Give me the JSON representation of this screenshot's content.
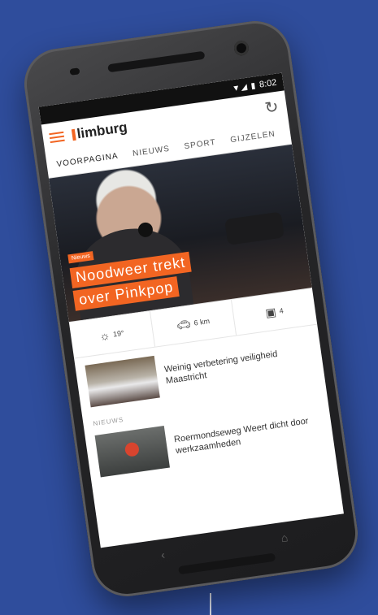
{
  "status_bar": {
    "icons": "▼◢ ▮",
    "time": "8:02"
  },
  "app": {
    "logo_text": "limburg"
  },
  "tabs": [
    {
      "label": "VOORPAGINA"
    },
    {
      "label": "NIEUWS"
    },
    {
      "label": "SPORT"
    },
    {
      "label": "GIJZELEN"
    }
  ],
  "hero": {
    "badge": "Nieuws",
    "headline_line1": "Noodweer trekt",
    "headline_line2": "over Pinkpop"
  },
  "info_strip": {
    "weather": {
      "icon": "sun-icon",
      "value": "19°"
    },
    "traffic": {
      "icon": "car-icon",
      "value": "6 km"
    },
    "camera": {
      "icon": "camera-icon",
      "value": "4"
    }
  },
  "news": [
    {
      "title": "Weinig verbetering veiligheid Maastricht"
    },
    {
      "section": "NIEUWS",
      "title": "Roermondseweg Weert dicht door werkzaamheden"
    }
  ],
  "colors": {
    "accent": "#f26522",
    "background": "#2f4d9c"
  }
}
